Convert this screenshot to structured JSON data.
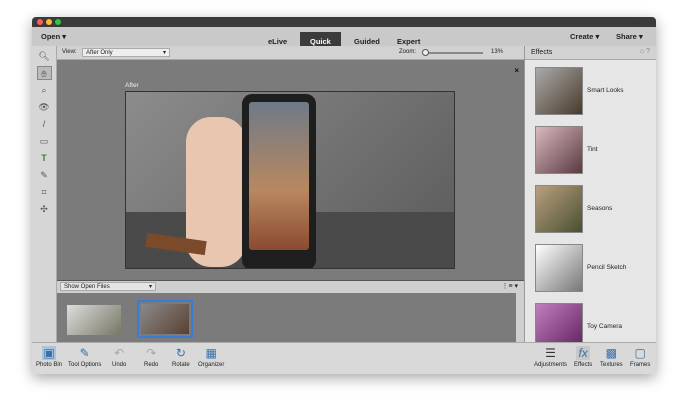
{
  "menu": {
    "open": "Open",
    "tabs": [
      "eLive",
      "Quick",
      "Guided",
      "Expert"
    ],
    "active_tab": "Quick",
    "create": "Create",
    "share": "Share"
  },
  "options": {
    "view_label": "View:",
    "view_value": "After Only",
    "zoom_label": "Zoom:",
    "zoom_value": "13%",
    "zoom_fraction": 0.13
  },
  "canvas": {
    "label": "After"
  },
  "strip": {
    "select": "Show Open Files"
  },
  "effects": {
    "title": "Effects",
    "items": [
      "Smart Looks",
      "Tint",
      "Seasons",
      "Pencil Sketch",
      "Toy Camera"
    ]
  },
  "bottom": {
    "left": [
      "Photo Bin",
      "Tool Options",
      "Undo",
      "Redo",
      "Rotate",
      "Organizer"
    ],
    "right": [
      "Adjustments",
      "Effects",
      "Textures",
      "Frames"
    ]
  },
  "colors": {
    "close": "#fc5f57",
    "min": "#fdbc2e",
    "max": "#28c840"
  }
}
